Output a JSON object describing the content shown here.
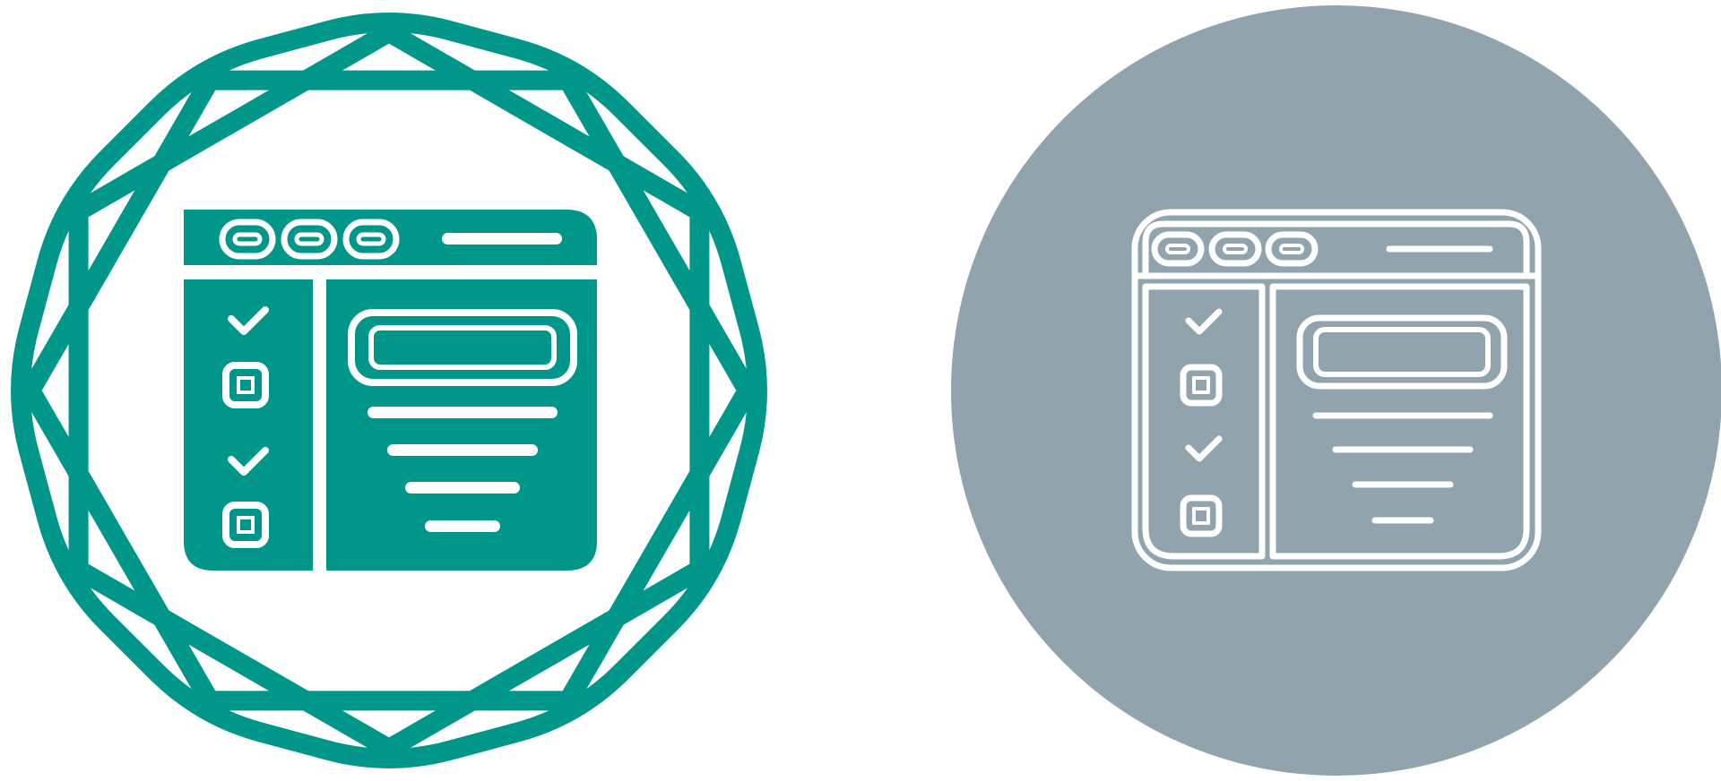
{
  "icons": [
    {
      "name": "browser-checklist-icon-badge-variant",
      "style": "glyph",
      "badge_shape": "scalloped-octagon-badge",
      "colors": {
        "primary": "#00978A",
        "background": "#FFFFFF"
      }
    },
    {
      "name": "browser-checklist-icon-circle-variant",
      "style": "line",
      "badge_shape": "circle",
      "colors": {
        "primary": "#FFFFFF",
        "background": "#91A3AD"
      }
    }
  ],
  "colors": {
    "page_background": "#FFFFFF"
  }
}
